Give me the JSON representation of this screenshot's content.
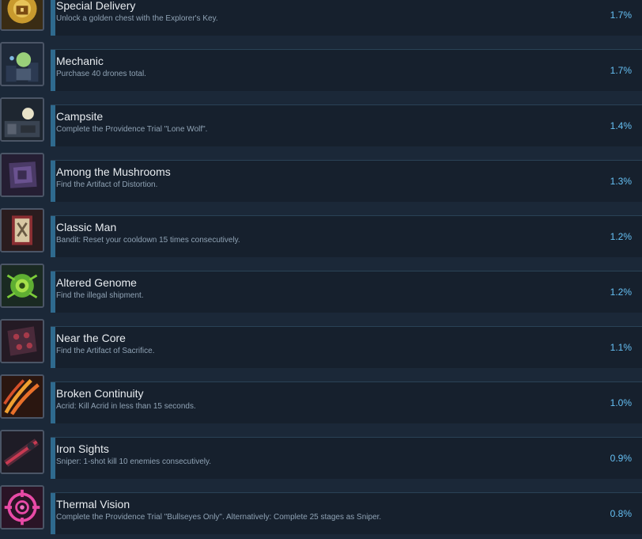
{
  "achievements": [
    {
      "title": "Special Delivery",
      "description": "Unlock a golden chest with the Explorer's Key.",
      "percent": "1.7%",
      "icon": "golden-chest-icon"
    },
    {
      "title": "Mechanic",
      "description": "Purchase 40 drones total.",
      "percent": "1.7%",
      "icon": "drone-icon"
    },
    {
      "title": "Campsite",
      "description": "Complete the Providence Trial \"Lone Wolf\".",
      "percent": "1.4%",
      "icon": "campsite-icon"
    },
    {
      "title": "Among the Mushrooms",
      "description": "Find the Artifact of Distortion.",
      "percent": "1.3%",
      "icon": "artifact-distortion-icon"
    },
    {
      "title": "Classic Man",
      "description": "Bandit: Reset your cooldown 15 times consecutively.",
      "percent": "1.2%",
      "icon": "scroll-icon"
    },
    {
      "title": "Altered Genome",
      "description": "Find the illegal shipment.",
      "percent": "1.2%",
      "icon": "genome-icon"
    },
    {
      "title": "Near the Core",
      "description": "Find the Artifact of Sacrifice.",
      "percent": "1.1%",
      "icon": "artifact-sacrifice-icon"
    },
    {
      "title": "Broken Continuity",
      "description": "Acrid: Kill Acrid in less than 15 seconds.",
      "percent": "1.0%",
      "icon": "claw-slash-icon"
    },
    {
      "title": "Iron Sights",
      "description": "Sniper: 1-shot kill 10 enemies consecutively.",
      "percent": "0.9%",
      "icon": "rifle-scope-icon"
    },
    {
      "title": "Thermal Vision",
      "description": "Complete the Providence Trial \"Bullseyes Only\". Alternatively: Complete 25 stages as Sniper.",
      "percent": "0.8%",
      "icon": "crosshair-icon"
    }
  ]
}
